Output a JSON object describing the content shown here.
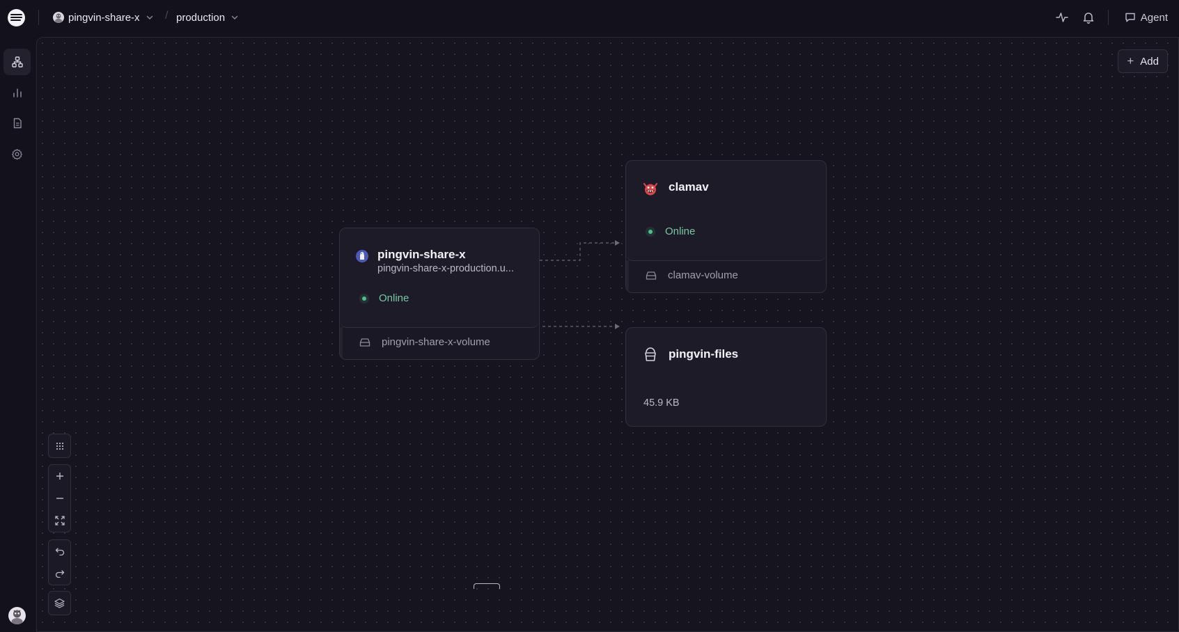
{
  "header": {
    "project_name": "pingvin-share-x",
    "environment": "production",
    "agent_label": "Agent"
  },
  "icons": {
    "logo": "railway-logo",
    "activity": "activity-icon",
    "bell": "bell-icon",
    "chat": "message-square-icon"
  },
  "sidebar": {
    "items": [
      {
        "name": "architecture",
        "icon": "network-icon",
        "active": true
      },
      {
        "name": "observability",
        "icon": "bar-chart-icon",
        "active": false
      },
      {
        "name": "logs",
        "icon": "document-icon",
        "active": false
      },
      {
        "name": "settings",
        "icon": "gear-icon",
        "active": false
      }
    ]
  },
  "canvas": {
    "add_label": "Add",
    "services": [
      {
        "id": "pingvin",
        "title": "pingvin-share-x",
        "subtitle": "pingvin-share-x-production.u...",
        "status": "Online",
        "volume": "pingvin-share-x-volume"
      },
      {
        "id": "clamav",
        "title": "clamav",
        "status": "Online",
        "volume": "clamav-volume"
      },
      {
        "id": "bucket",
        "title": "pingvin-files",
        "size": "45.9 KB"
      }
    ]
  },
  "colors": {
    "background": "#13111c",
    "canvas": "#16141f",
    "card": "#1d1b27",
    "online": "#4ac08c",
    "border": "#34313f"
  }
}
